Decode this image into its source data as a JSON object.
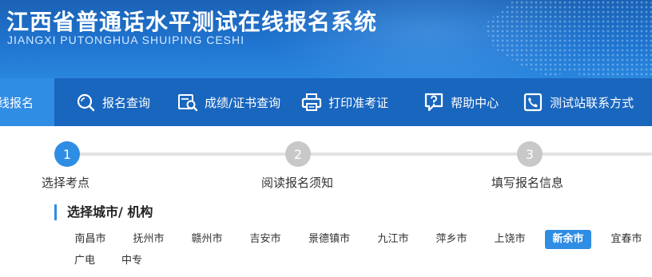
{
  "banner": {
    "title": "江西省普通话水平测试在线报名系统",
    "subtitle": "JIANGXI PUTONGHUA SHUIPING CESHI"
  },
  "nav": {
    "items": [
      {
        "label": "线报名",
        "icon": "",
        "active": true
      },
      {
        "label": "报名查询",
        "icon": "search-icon"
      },
      {
        "label": "成绩/证书查询",
        "icon": "certificate-search-icon"
      },
      {
        "label": "打印准考证",
        "icon": "printer-icon"
      },
      {
        "label": "帮助中心",
        "icon": "help-icon"
      },
      {
        "label": "测试站联系方式",
        "icon": "phone-icon"
      }
    ]
  },
  "steps": [
    {
      "number": "1",
      "label": "选择考点",
      "active": true
    },
    {
      "number": "2",
      "label": "阅读报名须知",
      "active": false
    },
    {
      "number": "3",
      "label": "填写报名信息",
      "active": false
    }
  ],
  "section": {
    "title": "选择城市/ 机构"
  },
  "cities": {
    "row1": [
      "南昌市",
      "抚州市",
      "赣州市",
      "吉安市",
      "景德镇市",
      "九江市",
      "萍乡市",
      "上饶市",
      "新余市",
      "宜春市"
    ],
    "row2": [
      "广电",
      "中专"
    ],
    "selected": "新余市"
  },
  "colors": {
    "banner": "#1f74cf",
    "nav": "#1966be",
    "accent": "#2f8de4",
    "inactive_step": "#c8c8c8"
  }
}
